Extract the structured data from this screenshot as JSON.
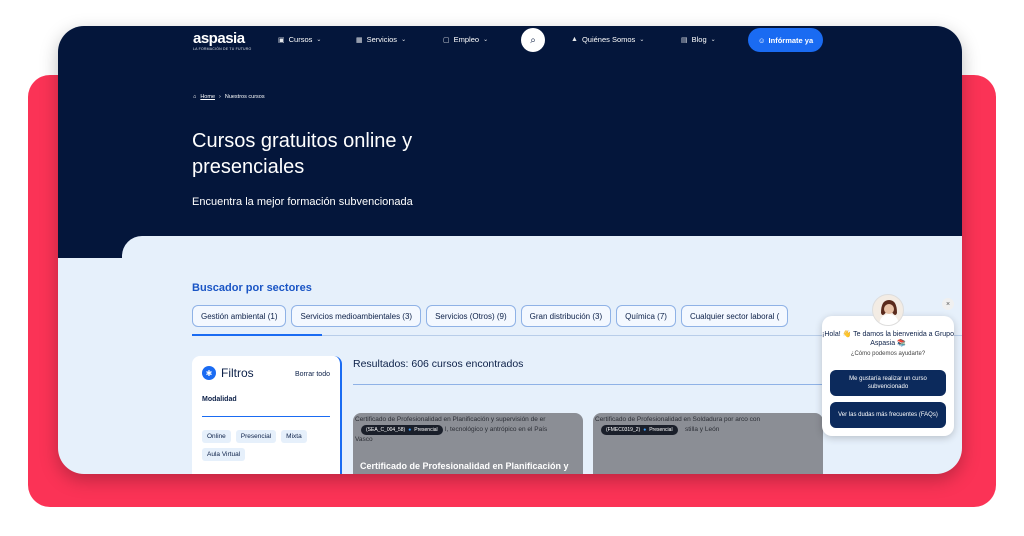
{
  "nav": {
    "logo": "aspasia",
    "logo_tagline": "LA FORMACIÓN DE TU FUTURO",
    "items": [
      {
        "label": "Cursos",
        "icon": "book-icon"
      },
      {
        "label": "Servicios",
        "icon": "grid-icon"
      },
      {
        "label": "Empleo",
        "icon": "briefcase-icon"
      },
      {
        "label": "Quiénes Somos",
        "icon": "building-icon"
      },
      {
        "label": "Blog",
        "icon": "news-icon"
      }
    ],
    "cta_label": "Infórmate ya"
  },
  "breadcrumb": {
    "home": "Home",
    "separator": "›",
    "current": "Nuestros cursos"
  },
  "hero": {
    "title_line1": "Cursos gratuitos online y",
    "title_line2": "presenciales",
    "subtitle": "Encuentra la mejor formación subvencionada"
  },
  "sectors": {
    "heading": "Buscador por sectores",
    "chips": [
      "Gestión ambiental (1)",
      "Servicios medioambientales (3)",
      "Servicios (Otros) (9)",
      "Gran distribución (3)",
      "Química (7)",
      "Cualquier sector laboral ("
    ]
  },
  "filters": {
    "title": "Filtros",
    "clear_all": "Borrar todo",
    "modality_label": "Modalidad",
    "modalities": [
      "Online",
      "Presencial",
      "Mixta",
      "Aula Virtual"
    ]
  },
  "results": {
    "summary": "Resultados: 606 cursos encontrados",
    "courses": [
      {
        "alt_text": "Certificado de Profesionalidad en Planificación y supervisión de er",
        "alt_text_2": "l, tecnológico y antrópico en el País",
        "alt_text_3": "Vasco",
        "code": "(SEA_C_004_58)",
        "modality": "Presencial",
        "title": "Certificado de Profesionalidad en Planificación y"
      },
      {
        "alt_text": "Certificado de Profesionalidad en Soldadura por arco con",
        "alt_text_2": "stilla y León",
        "code": "(FMEC0319_2)",
        "modality": "Presencial",
        "title": ""
      }
    ]
  },
  "chat": {
    "greeting": "¡Hola! 👋 Te damos la bienvenida a Grupo Aspasia 📚",
    "question": "¿Cómo podemos ayudarte?",
    "btn1": "Me gustaría realizar un curso subvencionado",
    "btn2": "Ver las dudas más frecuentes (FAQs)",
    "close": "×"
  },
  "colors": {
    "backdrop": "#fb3356",
    "hero_bg": "#04163b",
    "accent": "#1a6bf2",
    "page_bg": "#e6f0fb"
  }
}
